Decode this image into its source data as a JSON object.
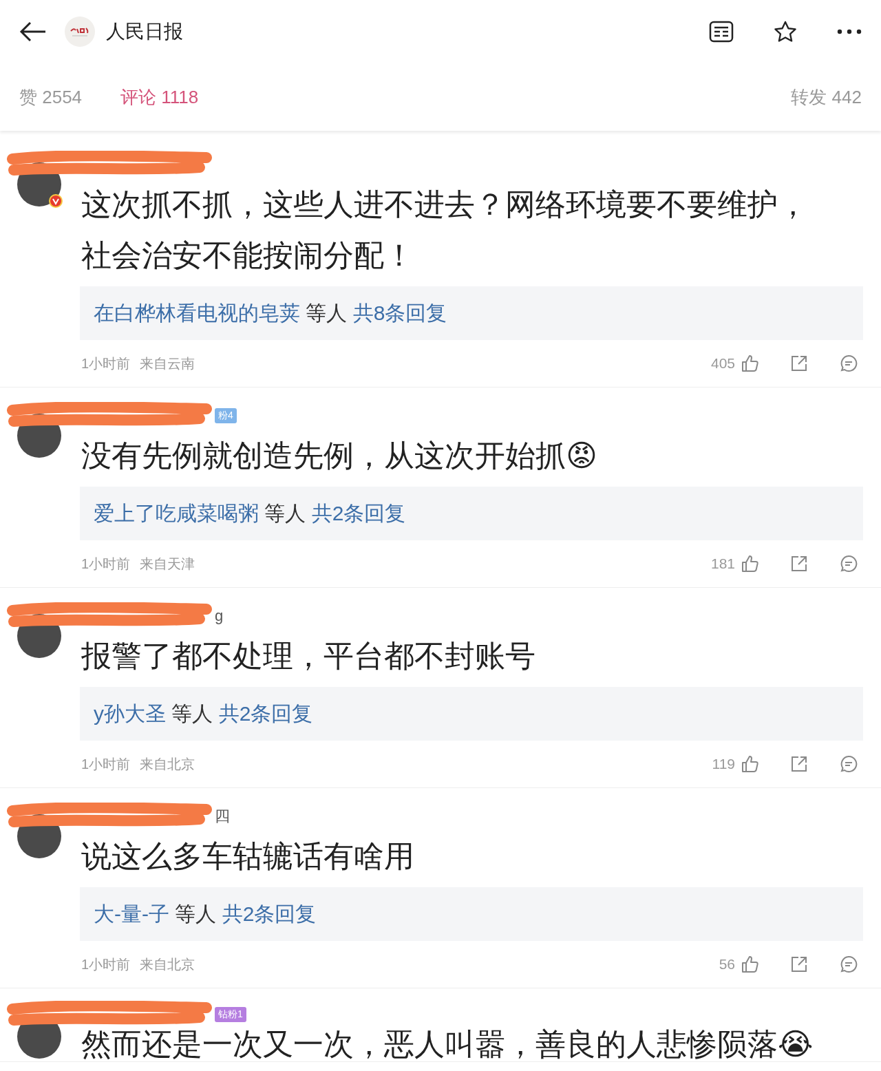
{
  "header": {
    "title": "人民日报"
  },
  "tabs": [
    {
      "label": "赞 2554",
      "selected": false
    },
    {
      "label": "评论 1118",
      "selected": true
    },
    {
      "label": "转发 442",
      "selected": false
    }
  ],
  "comments": [
    {
      "lines": [
        "这次抓不抓，这些人进不进去？网络环境要不要维护，",
        "社会治安不能按闹分配！"
      ],
      "verified": true,
      "replies": {
        "name": "在白桦林看电视的皂荚",
        "others": "等人",
        "total": "共8条回复"
      },
      "time": "1小时前",
      "location": "来自云南",
      "likes": "405"
    },
    {
      "name_tail": {
        "kind": "badge",
        "text": "粉4",
        "color": "#7fb4ea"
      },
      "lines": [
        "没有先例就创造先例，从这次开始抓😡"
      ],
      "verified": false,
      "replies": {
        "name": "爱上了吃咸菜喝粥",
        "others": "等人",
        "total": "共2条回复"
      },
      "time": "1小时前",
      "location": "来自天津",
      "likes": "181"
    },
    {
      "name_tail": {
        "kind": "text",
        "text": "g"
      },
      "lines": [
        "报警了都不处理，平台都不封账号"
      ],
      "verified": false,
      "replies": {
        "name": "y孙大圣",
        "others": "等人",
        "total": "共2条回复"
      },
      "time": "1小时前",
      "location": "来自北京",
      "likes": "119"
    },
    {
      "name_tail": {
        "kind": "text",
        "text": "四"
      },
      "lines": [
        "说这么多车轱辘话有啥用"
      ],
      "verified": false,
      "replies": {
        "name": "大-量-子",
        "others": "等人",
        "total": "共2条回复"
      },
      "time": "1小时前",
      "location": "来自北京",
      "likes": "56"
    },
    {
      "name_tail": {
        "kind": "badge",
        "text": "钻粉1",
        "color": "#b57ee0"
      },
      "lines": [
        "然而还是一次又一次，恶人叫嚣，善良的人悲惨陨落😭"
      ],
      "verified": false
    }
  ]
}
